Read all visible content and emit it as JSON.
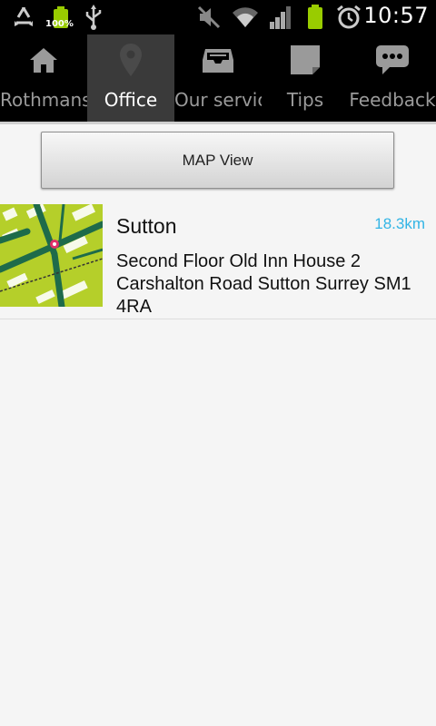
{
  "status_bar": {
    "battery_level_label": "100%",
    "time": "10:57",
    "icons": [
      "recycle-icon",
      "battery-icon",
      "usb-icon",
      "mute-icon",
      "wifi-icon",
      "signal-icon",
      "battery-icon",
      "alarm-icon"
    ]
  },
  "tabs": [
    {
      "label": "Rothmans",
      "icon": "home-icon",
      "active": false
    },
    {
      "label": "Office",
      "icon": "location-pin-icon",
      "active": true
    },
    {
      "label": "Our servic",
      "icon": "inbox-icon",
      "active": false
    },
    {
      "label": "Tips",
      "icon": "note-icon",
      "active": false
    },
    {
      "label": "Feedback",
      "icon": "speech-bubble-icon",
      "active": false
    }
  ],
  "map_button": {
    "label": "MAP View"
  },
  "offices": [
    {
      "name": "Sutton",
      "distance": "18.3km",
      "address": "Second Floor Old Inn House 2 Carshalton Road Sutton Surrey SM1 4RA"
    }
  ],
  "colors": {
    "accent": "#33b5e5",
    "tab_active_bg": "#3a3a3a",
    "map_green": "#b5cf2a",
    "map_road": "#1e6b4a"
  }
}
